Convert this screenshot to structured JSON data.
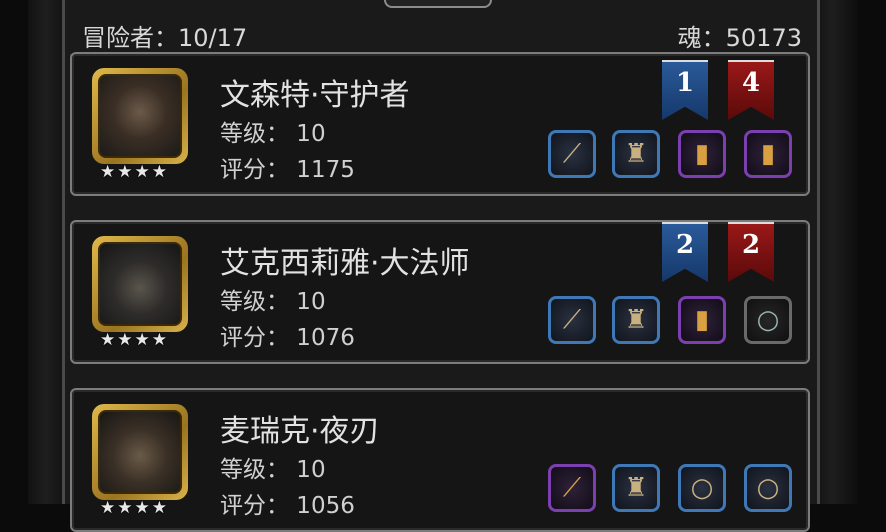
{
  "header": {
    "adventurers_label": "冒险者：",
    "adventurers_count": "10/17",
    "soul_label": "魂：",
    "soul_value": "50173"
  },
  "heroes": [
    {
      "name": "文森特·守护者",
      "level": "等级：  10",
      "score": "评分：  1175",
      "stars": "★★★★",
      "badge_blue": "1",
      "badge_red": "4",
      "equipment": [
        {
          "icon": "dagger-icon",
          "rarity": "blue"
        },
        {
          "icon": "armor-icon",
          "rarity": "blue"
        },
        {
          "icon": "scroll-icon",
          "rarity": "purple"
        },
        {
          "icon": "scroll-icon",
          "rarity": "purple"
        }
      ]
    },
    {
      "name": "艾克西莉雅·大法师",
      "level": "等级：  10",
      "score": "评分：  1076",
      "stars": "★★★★",
      "badge_blue": "2",
      "badge_red": "2",
      "equipment": [
        {
          "icon": "staff-icon",
          "rarity": "blue"
        },
        {
          "icon": "armor-icon",
          "rarity": "blue"
        },
        {
          "icon": "scroll-icon",
          "rarity": "purple"
        },
        {
          "icon": "ring-icon",
          "rarity": "gray"
        }
      ]
    },
    {
      "name": "麦瑞克·夜刃",
      "level": "等级：  10",
      "score": "评分：  1056",
      "stars": "★★★★",
      "equipment": [
        {
          "icon": "blade-icon",
          "rarity": "purple"
        },
        {
          "icon": "armor-icon",
          "rarity": "blue"
        },
        {
          "icon": "ring-icon",
          "rarity": "blue"
        },
        {
          "icon": "ring-icon",
          "rarity": "blue"
        }
      ]
    }
  ],
  "colors": {
    "blue_slot": "#3f78b6",
    "purple_slot": "#7b3fb0",
    "gray_slot": "#6a6a6a",
    "gold_frame": "#d9b24a"
  }
}
